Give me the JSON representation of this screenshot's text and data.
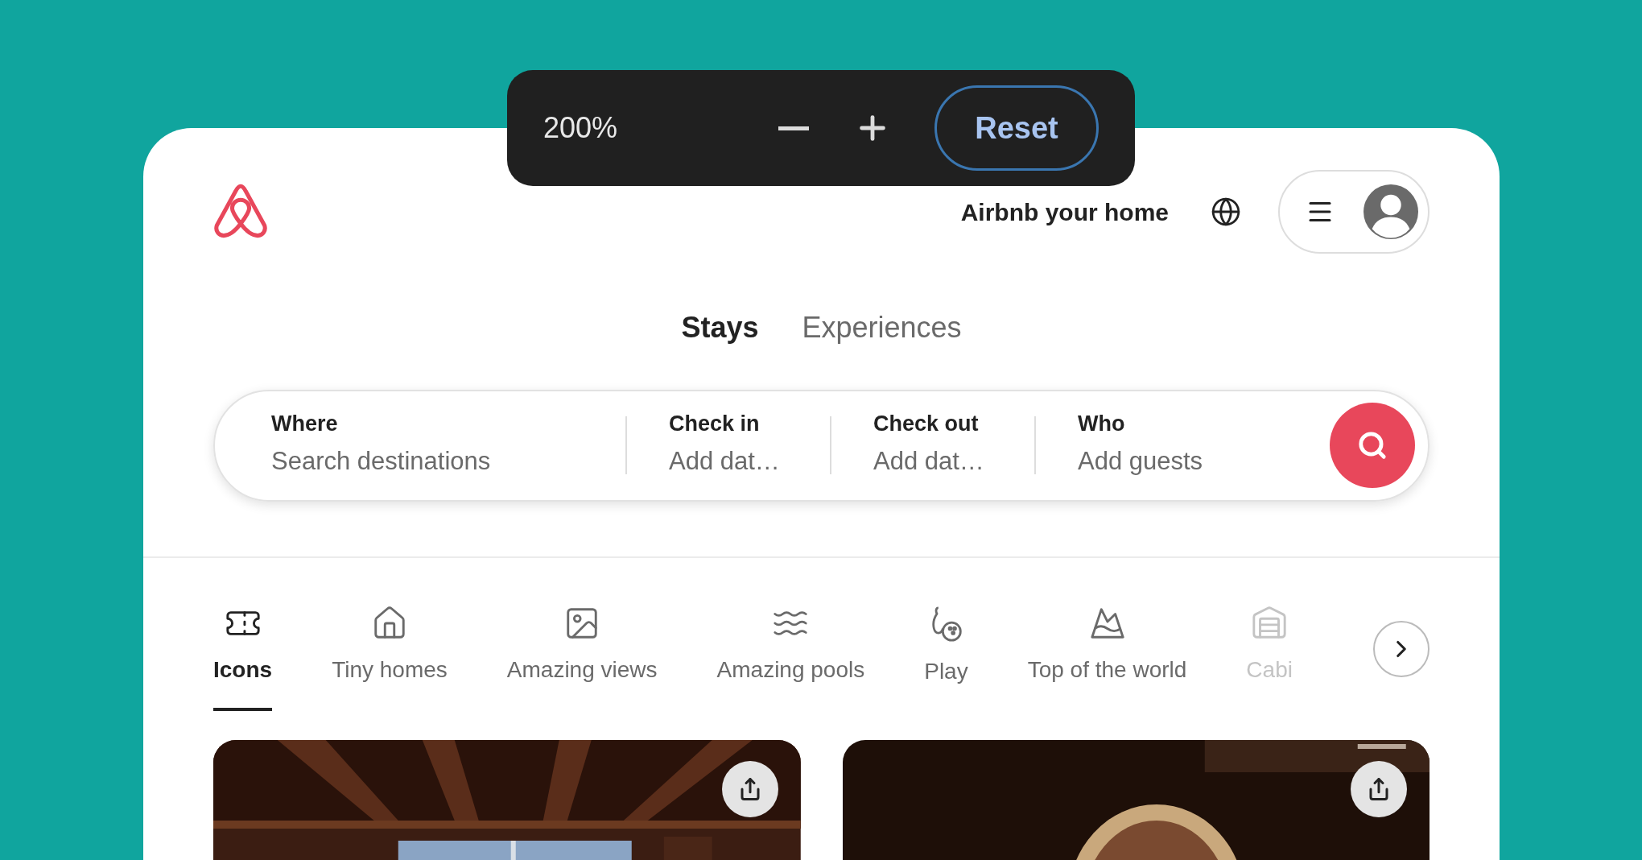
{
  "zoom_bar": {
    "level": "200%",
    "reset": "Reset"
  },
  "header": {
    "host_link": "Airbnb your home"
  },
  "tabs": [
    {
      "label": "Stays",
      "selected": true
    },
    {
      "label": "Experiences",
      "selected": false
    }
  ],
  "search": {
    "fields": [
      {
        "label": "Where",
        "placeholder": "Search destinations"
      },
      {
        "label": "Check in",
        "placeholder": "Add dat…"
      },
      {
        "label": "Check out",
        "placeholder": "Add dat…"
      },
      {
        "label": "Who",
        "placeholder": "Add guests"
      }
    ]
  },
  "categories": [
    {
      "label": "Icons",
      "kind": "ticket",
      "selected": true
    },
    {
      "label": "Tiny homes",
      "kind": "tiny",
      "selected": false
    },
    {
      "label": "Amazing views",
      "kind": "views",
      "selected": false
    },
    {
      "label": "Amazing pools",
      "kind": "pools",
      "selected": false
    },
    {
      "label": "Play",
      "kind": "play",
      "selected": false
    },
    {
      "label": "Top of the world",
      "kind": "top",
      "selected": false
    },
    {
      "label": "Cabi",
      "kind": "cabin",
      "selected": false
    }
  ]
}
